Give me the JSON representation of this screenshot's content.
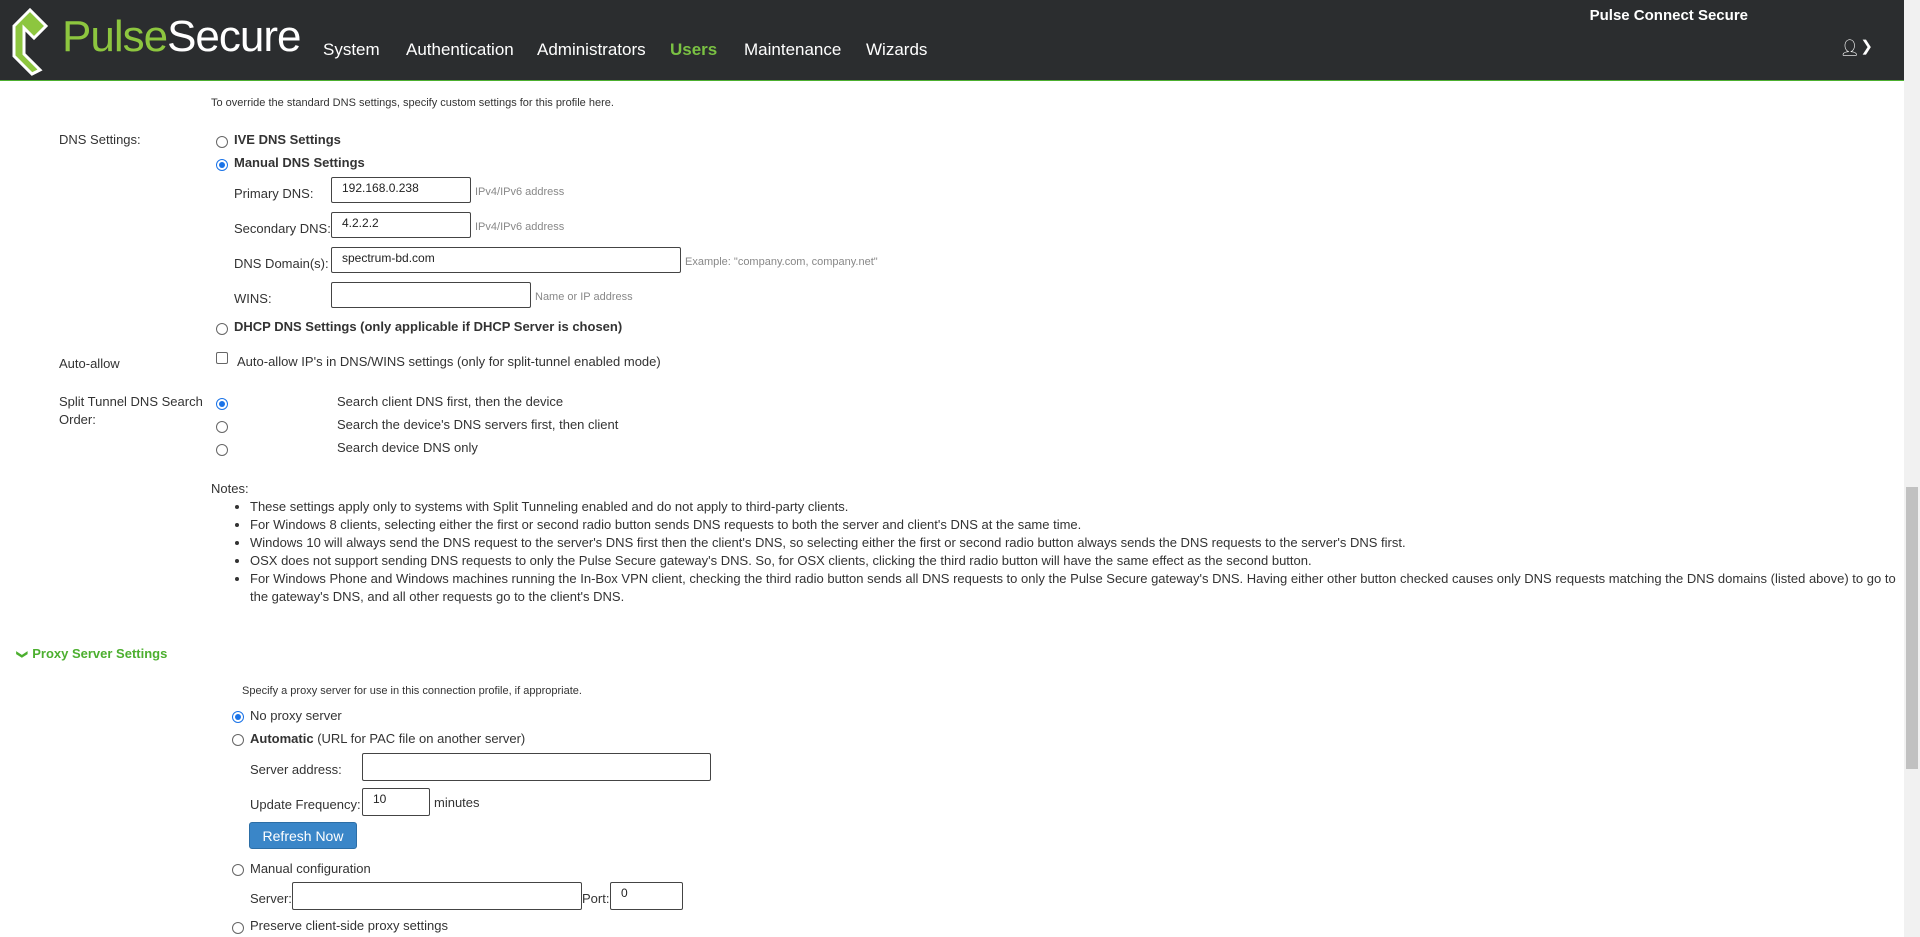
{
  "header": {
    "logo_pulse": "Pulse",
    "logo_secure": "Secure",
    "product_name": "Pulse Connect Secure",
    "nav": [
      "System",
      "Authentication",
      "Administrators",
      "Users",
      "Maintenance",
      "Wizards"
    ],
    "active_nav": "Users",
    "user_icon": "user-icon",
    "menu_icon": "chevron-down-icon"
  },
  "dns": {
    "intro": "To override the standard DNS settings, specify custom settings for this profile here.",
    "label": "DNS Settings:",
    "ive_option": "IVE DNS Settings",
    "manual_option": "Manual DNS Settings",
    "primary_label": "Primary DNS:",
    "primary_value": "192.168.0.238",
    "primary_hint": "IPv4/IPv6 address",
    "secondary_label": "Secondary DNS:",
    "secondary_value": "4.2.2.2",
    "secondary_hint": "IPv4/IPv6 address",
    "domain_label": "DNS Domain(s):",
    "domain_value": "spectrum-bd.com",
    "domain_hint": "Example: \"company.com, company.net\"",
    "wins_label": "WINS:",
    "wins_value": "",
    "wins_hint": "Name or IP address",
    "dhcp_option": "DHCP DNS Settings (only applicable if DHCP Server is chosen)",
    "selected": "manual"
  },
  "auto_allow": {
    "label": "Auto-allow",
    "checkbox_label": "Auto-allow IP's in DNS/WINS settings (only for split-tunnel enabled mode)",
    "checked": false
  },
  "split_tunnel": {
    "label_line1": "Split Tunnel DNS Search",
    "label_line2": "Order:",
    "options": [
      "Search client DNS first, then the device",
      "Search the device's DNS servers first, then client",
      "Search device DNS only"
    ],
    "selected_index": 0
  },
  "notes": {
    "title": "Notes:",
    "items": [
      "These settings apply only to systems with Split Tunneling enabled and do not apply to third-party clients.",
      "For Windows 8 clients, selecting either the first or second radio button sends DNS requests to both the server and client's DNS at the same time.",
      "Windows 10 will always send the DNS request to the server's DNS first then the client's DNS, so selecting either the first or second radio button always sends the DNS requests to the server's DNS first.",
      "OSX does not support sending DNS requests to only the Pulse Secure gateway's DNS. So, for OSX clients, clicking the third radio button will have the same effect as the second button.",
      "For Windows Phone and Windows machines running the In-Box VPN client, checking the third radio button sends all DNS requests to only the Pulse Secure gateway's DNS. Having either other button checked causes only DNS requests matching the DNS domains (listed above) to go to the gateway's DNS, and all other requests go to the client's DNS."
    ]
  },
  "proxy": {
    "section_title": "Proxy Server Settings",
    "intro": "Specify a proxy server for use in this connection profile, if appropriate.",
    "no_proxy": "No proxy server",
    "automatic_bold": "Automatic",
    "automatic_rest": "(URL for PAC file on another server)",
    "server_address_label": "Server address:",
    "server_address_value": "",
    "update_freq_label": "Update Frequency:",
    "update_freq_value": "10",
    "update_freq_unit": "minutes",
    "refresh_button": "Refresh Now",
    "manual_option": "Manual configuration",
    "server_label": "Server:",
    "server_value": "",
    "port_label": "Port:",
    "port_value": "0",
    "preserve_option": "Preserve client-side proxy settings",
    "selected": "none"
  }
}
